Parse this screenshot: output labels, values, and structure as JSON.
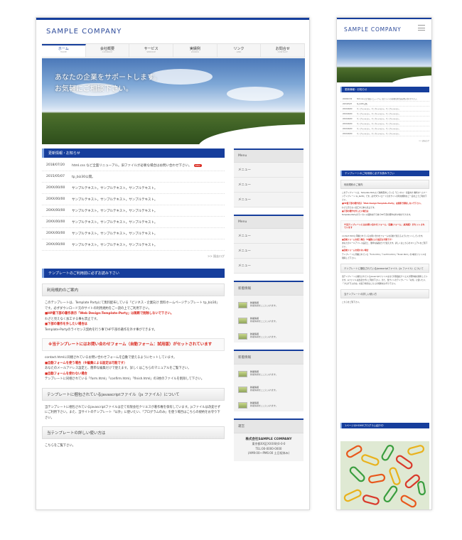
{
  "company": "SAMPLE COMPANY",
  "nav": [
    {
      "label": "ホーム",
      "sub": "HOME"
    },
    {
      "label": "会社概要",
      "sub": "COMPANY"
    },
    {
      "label": "サービス",
      "sub": "SERVICE"
    },
    {
      "label": "実績例",
      "sub": "WORKS"
    },
    {
      "label": "リンク",
      "sub": "LINK"
    },
    {
      "label": "お問合せ",
      "sub": "CONTACT"
    }
  ],
  "hero": {
    "line1": "あなたの企業をサポートします。",
    "line2": "お気軽にご相談下さい。"
  },
  "news": {
    "title": "更新情報・お知らせ",
    "items": [
      {
        "date": "2018/07/20",
        "text": "html.css など全面リニューアル。旧ファイルが必要な場合はお問い合わせ下さい。",
        "badge": "NEW"
      },
      {
        "date": "2015/05/07",
        "text": "tp_biz30公開。"
      },
      {
        "date": "20XX/00/00",
        "text": "サンプルテキスト。サンプルテキスト。サンプルテキスト。"
      },
      {
        "date": "20XX/00/00",
        "text": "サンプルテキスト。サンプルテキスト。サンプルテキスト。"
      },
      {
        "date": "20XX/00/00",
        "text": "サンプルテキスト。サンプルテキスト。サンプルテキスト。"
      },
      {
        "date": "20XX/00/00",
        "text": "サンプルテキスト。サンプルテキスト。サンプルテキスト。"
      },
      {
        "date": "20XX/00/00",
        "text": "サンプルテキスト。サンプルテキスト。サンプルテキスト。"
      },
      {
        "date": "20XX/00/00",
        "text": "サンプルテキスト。サンプルテキスト。サンプルテキスト。"
      }
    ],
    "more": ">> 過去ログ"
  },
  "template": {
    "title": "テンプレートのご利用前に必ずお読み下さい",
    "terms_heading": "利用規約のご案内",
    "terms_text1": "このテンプレートは、Template Partyにて無料配布している「ビジネス・企業向け 無料ホームページテンプレート tp_biz30」です。必ずダウンロード元のサイトの利用規約をご一読の上でご利用下さい。",
    "terms_red1": "■HP最下部の著作表示「Web Design:Template-Party」は無断で削除しないで下さい。",
    "terms_text2": "わざと見えなく加工する事も禁止です。",
    "terms_red2": "■下部の著作を外したい場合は",
    "terms_text3": "Template-Partyのライセンス契約を行う事でHP下部の著作を外す事ができます。",
    "form_notice": "※当テンプレートにはお問い合わせフォーム（自動フォーム：試用版）がセットされています",
    "form_text1": "contact.htmlに同梱されているお問い合わせフォームを自動で使えるようにセットしています。",
    "form_red1": "■自動フォームを使う場合（※編集による設定は可能です）",
    "form_text2": "あなたのメールアドレス設定と、簡単な編集だけで使えます。詳しくはこちらのマニュアルをご覧下さい。",
    "form_red2": "■自動フォームを使わない場合",
    "form_text3": "テンプレートに同梱されている「form.html」「confirm.html」「finish.html」の3枚のファイルを削除して下さい。",
    "js_heading": "テンプレートに梱包されているjavascriptファイル（js ファイル）について",
    "js_text": "当テンプレートに梱包されているjavascriptファイルは全て有限会社クリエスが著作権を保有しています。jsファイルは改変せずにご利用下さい。また、当サイトのテンプレート「以外」に使いたい、「プログラムのみ」を使う場合はこちらの規約をお守り下さい。",
    "usage_heading": "当テンプレートの詳しい使い方は",
    "usage_text": "こちらをご覧下さい。"
  },
  "sidebar": {
    "menu1": {
      "title": "Menu",
      "items": [
        "メニュー",
        "メニュー",
        "メニュー"
      ]
    },
    "menu2": {
      "title": "Menu",
      "items": [
        "メニュー",
        "メニュー",
        "メニュー"
      ]
    },
    "banner1": {
      "title": "新着情報",
      "items": [
        {
          "name": "新着情報",
          "desc": "新着情報をここに入れます。"
        },
        {
          "name": "新着情報",
          "desc": "新着情報をここに入れます。"
        },
        {
          "name": "新着情報",
          "desc": "新着情報をここに入れます。"
        }
      ]
    },
    "banner2": {
      "title": "新着情報",
      "items": [
        {
          "name": "新着情報",
          "desc": "新着情報をここに入れます。"
        },
        {
          "name": "新着情報",
          "desc": "新着情報をここに入れます。"
        },
        {
          "name": "新着情報",
          "desc": "新着情報をここに入れます。"
        }
      ]
    },
    "company": {
      "title": "運営",
      "name": "株式会社SAMPLE COMPANY",
      "addr": "東京都XX区XXXX町0-0-0",
      "tel": "TEL:00-0000-0000",
      "hours": "(AM9:00～PM6:00 土日祝休み)"
    }
  },
  "mobile": {
    "news_title": "更新情報・お知らせ",
    "template_title": "テンプレートのご利用前に必ずお読み下さい",
    "terms_heading": "利用規約のご案内",
    "js_heading": "テンプレートに梱包されているjavascriptファイル（js ファイル）について",
    "usage_heading": "当テンプレートの詳しい使い方",
    "usage_text": "こちらをご覧下さい。",
    "plugin_title": "1ページのHOMEプログラム紹介中"
  }
}
